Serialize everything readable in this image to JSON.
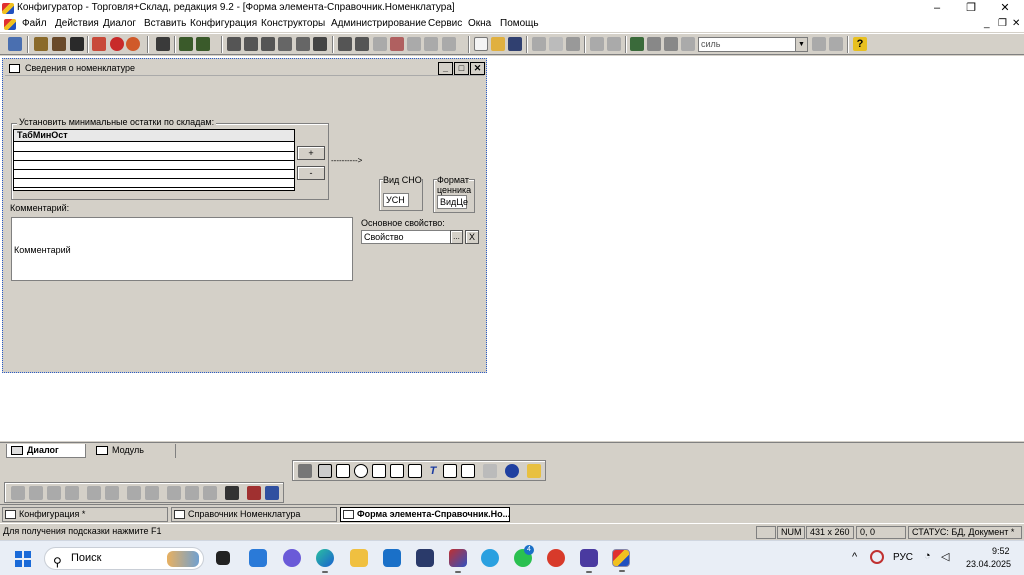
{
  "window": {
    "title": "Конфигуратор - Торговля+Склад, редакция 9.2 - [Форма элемента-Справочник.Номенклатура]",
    "controls": {
      "minimize": "–",
      "restore": "❐",
      "close": "✕"
    }
  },
  "menu": {
    "items": [
      "Файл",
      "Действия",
      "Диалог",
      "Вставить",
      "Конфигурация",
      "Конструкторы",
      "Администрирование",
      "Сервис",
      "Окна",
      "Помощь"
    ],
    "mdi_controls": {
      "minimize": "_",
      "restore": "❐",
      "close": "✕"
    }
  },
  "toolbar": {
    "search_value": "силь"
  },
  "dialog": {
    "title": "Сведения о номенклатуре",
    "controls": {
      "minimize": "_",
      "maximize": "□",
      "close": "✕"
    },
    "min_stock_group_label": "Установить минимальные остатки по складам:",
    "grid_header": "ТабМинОст",
    "plus_button": "+",
    "minus_button": "-",
    "arrow": "---------->",
    "vid_sno_label": "Вид СНО",
    "vid_sno_value": "УСН",
    "format_label_line1": "Формат",
    "format_label_line2": "ценника",
    "format_value": "ВидЦе",
    "comment_label": "Комментарий:",
    "comment_value": "Комментарий",
    "main_property_label": "Основное свойство:",
    "main_property_value": "Свойство",
    "select_button": "...",
    "clear_button": "X"
  },
  "tabs": [
    {
      "label": "Диалог",
      "active": true
    },
    {
      "label": "Модуль",
      "active": false
    }
  ],
  "mdi_windows": [
    {
      "label": "Конфигурация *",
      "active": false
    },
    {
      "label": "Справочник Номенклатура",
      "active": false
    },
    {
      "label": "Форма элемента-Справочник.Но...",
      "active": true
    }
  ],
  "statusbar": {
    "hint": "Для получения подсказки нажмите F1",
    "num": "NUM",
    "size": "431 x 260",
    "pos": "0, 0",
    "status": "СТАТУС: БД, Документ *"
  },
  "taskbar": {
    "search_placeholder": "Поиск",
    "language": "РУС",
    "time": "9:52",
    "date": "23.04.2025",
    "whatsapp_badge": "4"
  }
}
